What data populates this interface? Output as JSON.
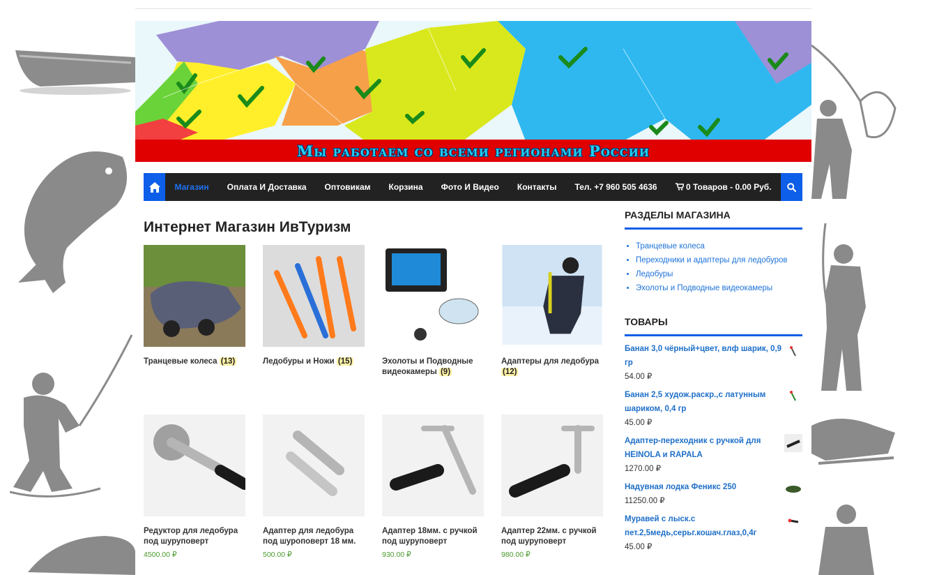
{
  "banner": {
    "slogan": "Мы работаем со всеми регионами России"
  },
  "nav": {
    "home_icon": "home-icon",
    "items": [
      {
        "label": "Магазин",
        "active": true
      },
      {
        "label": "Оплата И Доставка"
      },
      {
        "label": "Оптовикам"
      },
      {
        "label": "Корзина"
      },
      {
        "label": "Фото И Видео"
      },
      {
        "label": "Контакты"
      },
      {
        "label": "Тел. +7 960 505 4636"
      },
      {
        "label": "0 Товаров - 0.00 Руб."
      }
    ],
    "cart_icon": "cart-icon",
    "search_icon": "search-icon"
  },
  "main": {
    "title": "Интернет Магазин ИвТуризм",
    "categories": [
      {
        "name": "Транцевые колеса",
        "count": "(13)"
      },
      {
        "name": "Ледобуры и Ножи",
        "count": "(15)"
      },
      {
        "name": "Эхолоты и Подводные видеокамеры",
        "count": "(9)"
      },
      {
        "name": "Адаптеры для ледобура",
        "count": "(12)"
      }
    ],
    "products": [
      {
        "name": "Редуктор для ледобура под шуруповерт",
        "price": "4500.00 ₽"
      },
      {
        "name": "Адаптер для ледобура под шуроповерт 18 мм.",
        "price": "500.00 ₽"
      },
      {
        "name": "Адаптер 18мм. с ручкой под шуруповерт",
        "price": "930.00 ₽"
      },
      {
        "name": "Адаптер 22мм. с ручкой под шуруповерт",
        "price": "980.00 ₽"
      }
    ]
  },
  "sidebar": {
    "sections_title": "РАЗДЕЛЫ МАГАЗИНА",
    "sections": [
      "Транцевые колеса",
      "Переходники и адаптеры для ледобуров",
      "Ледобуры",
      "Эхолоты и Подводные видеокамеры"
    ],
    "goods_title": "ТОВАРЫ",
    "goods": [
      {
        "name": "Банан 3,0 чёрный+цвет, влф шарик, 0,9 гр",
        "price": "54.00 ₽"
      },
      {
        "name": "Банан 2,5 худож.раскр.,с латунным шариком, 0,4 гр",
        "price": "45.00 ₽"
      },
      {
        "name": "Адаптер-переходник с ручкой для HEINOLA и RAPALA",
        "price": "1270.00 ₽"
      },
      {
        "name": "Надувная лодка Феникс 250",
        "price": "11250.00 ₽"
      },
      {
        "name": "Муравей с лыск.с пет.2,5медь,серьг.кошач.глаз,0,4г",
        "price": "45.00 ₽"
      }
    ]
  },
  "colors": {
    "accent": "#0d5ee8",
    "nav_bg": "#222222",
    "banner_strip": "#e00000",
    "price_green": "#4a9a2c",
    "link_blue": "#1e6fc8"
  }
}
